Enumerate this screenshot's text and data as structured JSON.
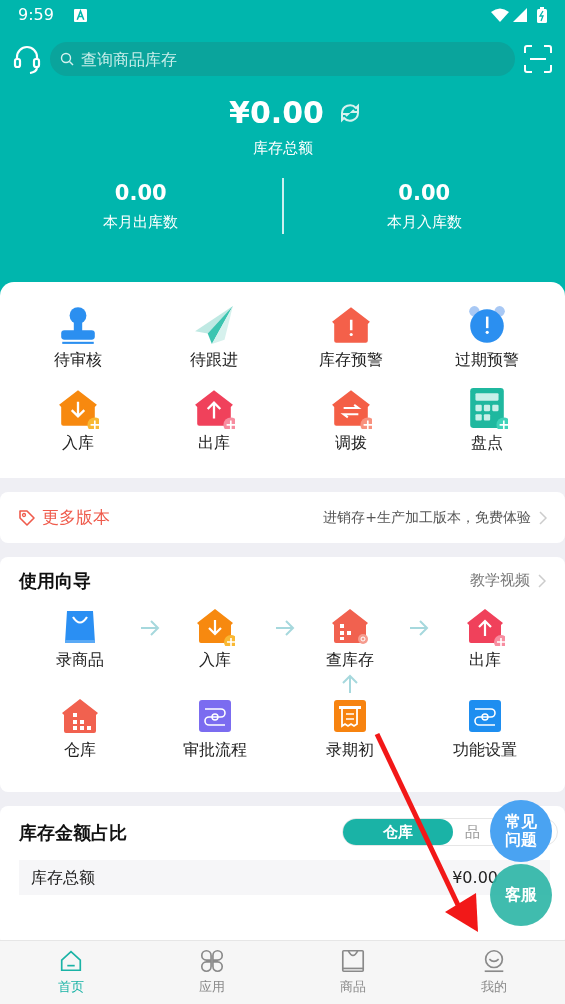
{
  "status_bar": {
    "time": "9:59"
  },
  "search": {
    "placeholder": "查询商品库存"
  },
  "summary": {
    "amount": "¥0.00",
    "label": "库存总额",
    "stats": [
      {
        "value": "0.00",
        "label": "本月出库数"
      },
      {
        "value": "0.00",
        "label": "本月入库数"
      }
    ]
  },
  "quick_actions": [
    {
      "kind": "stamp",
      "label": "待审核"
    },
    {
      "kind": "plane",
      "label": "待跟进"
    },
    {
      "kind": "house-alert",
      "label": "库存预警"
    },
    {
      "kind": "alarm",
      "label": "过期预警"
    },
    {
      "kind": "house-in",
      "label": "入库"
    },
    {
      "kind": "house-out",
      "label": "出库"
    },
    {
      "kind": "house-transfer",
      "label": "调拨"
    },
    {
      "kind": "calculator",
      "label": "盘点"
    }
  ],
  "promo": {
    "title": "更多版本",
    "text": "进销存+生产加工版本，免费体验"
  },
  "guide": {
    "title": "使用向导",
    "link": "教学视频",
    "steps": [
      {
        "kind": "bag",
        "label": "录商品"
      },
      {
        "kind": "house-in",
        "label": "入库"
      },
      {
        "kind": "house-grid-gear",
        "label": "查库存"
      },
      {
        "kind": "house-out",
        "label": "出库"
      }
    ],
    "extras": [
      {
        "kind": "house-grid",
        "label": "仓库"
      },
      {
        "kind": "flow-purple",
        "label": "审批流程"
      },
      {
        "kind": "receipt",
        "label": "录期初"
      },
      {
        "kind": "flow-blue",
        "label": "功能设置"
      }
    ]
  },
  "share": {
    "title": "库存金额占比",
    "segments": [
      {
        "label": "仓库",
        "selected": true
      },
      {
        "label": "品",
        "selected": false
      }
    ],
    "row": {
      "label": "库存总额",
      "value": "¥0.00"
    }
  },
  "floating": [
    "常见问题",
    "客服"
  ],
  "nav": [
    {
      "kind": "home",
      "label": "首页",
      "selected": true
    },
    {
      "kind": "apps",
      "label": "应用",
      "selected": false
    },
    {
      "kind": "goods",
      "label": "商品",
      "selected": false
    },
    {
      "kind": "me",
      "label": "我的",
      "selected": false
    }
  ]
}
